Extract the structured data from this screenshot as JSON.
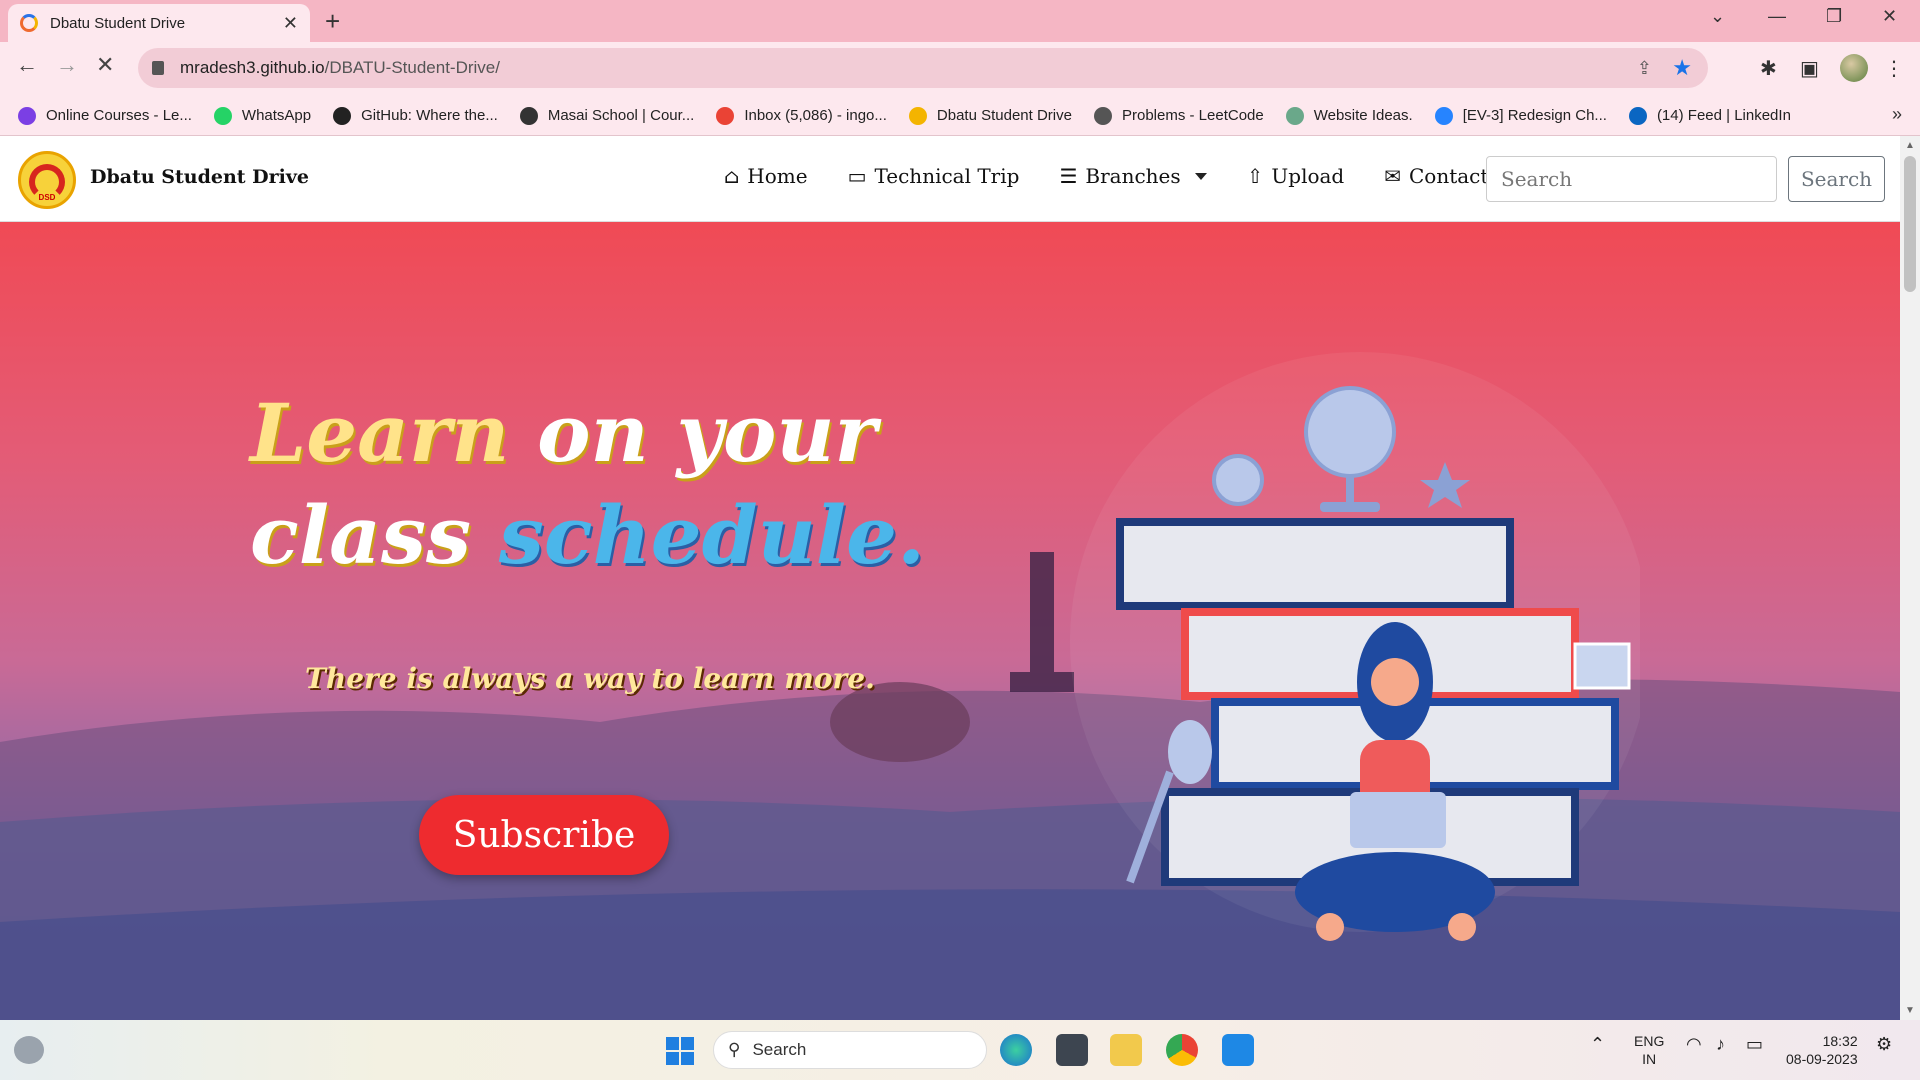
{
  "browser": {
    "tab_title": "Dbatu Student Drive",
    "url_host": "mradesh3.github.io",
    "url_path": "/DBATU-Student-Drive/",
    "bookmarks": [
      {
        "label": "Online Courses - Le...",
        "color": "#7b3fe4"
      },
      {
        "label": "WhatsApp",
        "color": "#25d366"
      },
      {
        "label": "GitHub: Where the...",
        "color": "#222222"
      },
      {
        "label": "Masai School | Cour...",
        "color": "#333333"
      },
      {
        "label": "Inbox (5,086) - ingo...",
        "color": "#ea4335"
      },
      {
        "label": "Dbatu Student Drive",
        "color": "#f4b400"
      },
      {
        "label": "Problems - LeetCode",
        "color": "#555555"
      },
      {
        "label": "Website Ideas.",
        "color": "#6aa88a"
      },
      {
        "label": "[EV-3] Redesign Ch...",
        "color": "#2684ff"
      },
      {
        "label": "(14) Feed | LinkedIn",
        "color": "#0a66c2"
      }
    ]
  },
  "site": {
    "brand": "Dbatu Student Drive",
    "logo_text": "DSD",
    "nav": [
      {
        "label": "Home",
        "icon": "home-icon"
      },
      {
        "label": "Technical Trip",
        "icon": "devices-icon"
      },
      {
        "label": "Branches",
        "icon": "server-icon"
      },
      {
        "label": "Upload",
        "icon": "upload-icon"
      },
      {
        "label": "Contact",
        "icon": "envelope-icon"
      }
    ],
    "search_placeholder": "Search",
    "search_button": "Search"
  },
  "hero": {
    "line1_a": "Learn",
    "line1_b": "on your",
    "line2_a": "class",
    "line2_b": "schedule.",
    "tagline": "There is always a way to learn more.",
    "cta": "Subscribe"
  },
  "taskbar": {
    "search_label": "Search",
    "lang_1": "ENG",
    "lang_2": "IN",
    "time": "18:32",
    "date": "08-09-2023"
  },
  "colors": {
    "accent_red": "#ee2b2f",
    "hero_top": "#f04a55",
    "hero_bottom": "#5f5aa0",
    "chrome_pink": "#f5b6c4"
  }
}
